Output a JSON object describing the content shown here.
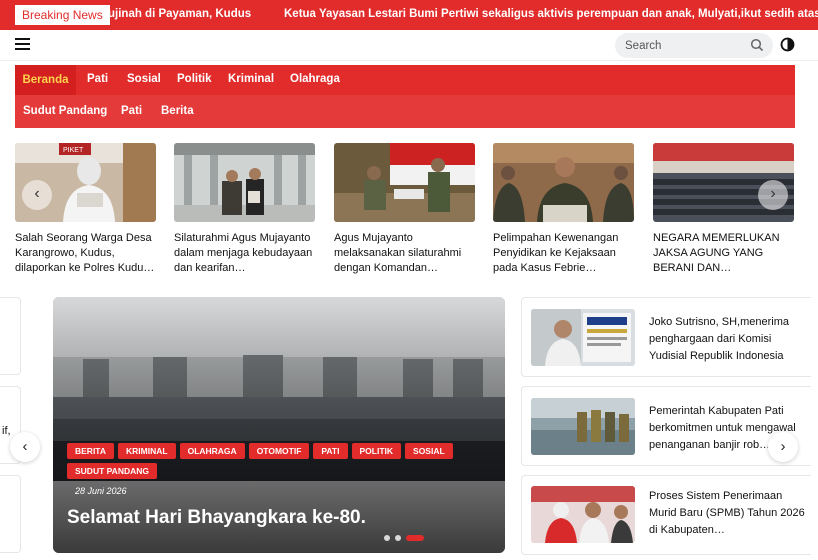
{
  "ticker": {
    "label": "Breaking News",
    "items": [
      "ujinah di Payaman, Kudus",
      "Ketua Yayasan Lestari Bumi Pertiwi sekaligus aktivis perempuan dan anak, Mulyati,ikut sedih atas ka"
    ]
  },
  "header": {
    "search_placeholder": "Search",
    "menu_icon": "hamburger-menu-icon",
    "search_icon": "search-icon",
    "mode_icon": "dark-mode-toggle-icon"
  },
  "nav": {
    "row1": [
      "Beranda",
      "Pati",
      "Sosial",
      "Politik",
      "Kriminal",
      "Olahraga"
    ],
    "row2": [
      "Sudut Pandang",
      "Pati",
      "Berita"
    ],
    "active": "Beranda"
  },
  "cards": [
    {
      "title": "Salah Seorang Warga Desa Karangrowo, Kudus, dilaporkan ke Polres Kudu…"
    },
    {
      "title": "Silaturahmi Agus Mujayanto dalam menjaga kebudayaan dan kearifan…"
    },
    {
      "title": "Agus Mujayanto melaksanakan silaturahmi dengan Komandan…"
    },
    {
      "title": "Pelimpahan Kewenangan Penyidikan ke Kejaksaan pada Kasus Febrie…"
    },
    {
      "title": "NEGARA MEMERLUKAN JAKSA AGUNG YANG BERANI DAN…"
    }
  ],
  "card_image_badge": "PIKET",
  "left_fragment": "if,",
  "slider": {
    "tags": [
      "BERITA",
      "KRIMINAL",
      "OLAHRAGA",
      "OTOMOTIF",
      "PATI",
      "POLITIK",
      "SOSIAL",
      "SUDUT PANDANG"
    ],
    "date": "28 Juni 2026",
    "title": "Selamat Hari Bhayangkara ke-80.",
    "slide_count": 3,
    "active_slide": 3
  },
  "right_list": [
    {
      "lines": [
        "Joko Sutrisno, SH,menerima",
        "penghargaan dari Komisi",
        "Yudisial Republik Indonesia"
      ]
    },
    {
      "lines": [
        "Pemerintah Kabupaten Pati",
        "berkomitmen untuk mengawal",
        "penanganan banjir rob…"
      ]
    },
    {
      "lines": [
        "Proses Sistem Penerimaan",
        "Murid Baru (SPMB) Tahun 2026",
        "di Kabupaten…"
      ]
    }
  ],
  "colors": {
    "brand_red": "#e22b2b",
    "active_nav_text": "#ffd24d"
  }
}
